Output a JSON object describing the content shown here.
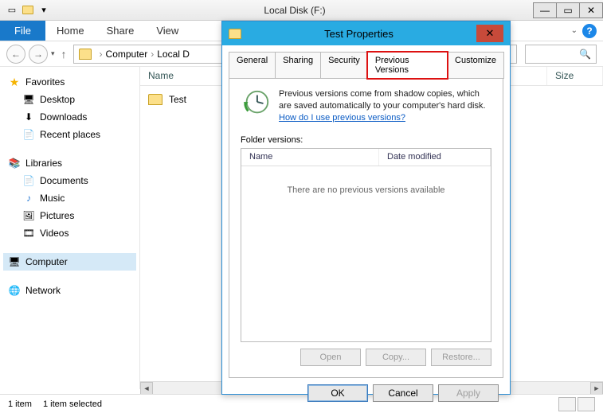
{
  "window": {
    "title": "Local Disk (F:)"
  },
  "ribbon": {
    "file": "File",
    "tabs": [
      "Home",
      "Share",
      "View"
    ]
  },
  "breadcrumb": {
    "segments": [
      "Computer",
      "Local D"
    ]
  },
  "nav": {
    "favorites": {
      "label": "Favorites",
      "items": [
        "Desktop",
        "Downloads",
        "Recent places"
      ]
    },
    "libraries": {
      "label": "Libraries",
      "items": [
        "Documents",
        "Music",
        "Pictures",
        "Videos"
      ]
    },
    "computer": {
      "label": "Computer"
    },
    "network": {
      "label": "Network"
    }
  },
  "columns": {
    "name": "Name",
    "size": "Size"
  },
  "files": {
    "items": [
      {
        "name": "Test"
      }
    ]
  },
  "status": {
    "count": "1 item",
    "selected": "1 item selected"
  },
  "dialog": {
    "title": "Test Properties",
    "tabs": [
      "General",
      "Sharing",
      "Security",
      "Previous Versions",
      "Customize"
    ],
    "active_tab_index": 3,
    "info_line1": "Previous versions come from shadow copies, which",
    "info_line2": "are saved automatically to your computer's hard disk.",
    "info_link": "How do I use previous versions?",
    "fv_label": "Folder versions:",
    "fv_cols": {
      "name": "Name",
      "date": "Date modified"
    },
    "fv_empty": "There are no previous versions available",
    "fv_buttons": {
      "open": "Open",
      "copy": "Copy...",
      "restore": "Restore..."
    },
    "buttons": {
      "ok": "OK",
      "cancel": "Cancel",
      "apply": "Apply"
    }
  }
}
